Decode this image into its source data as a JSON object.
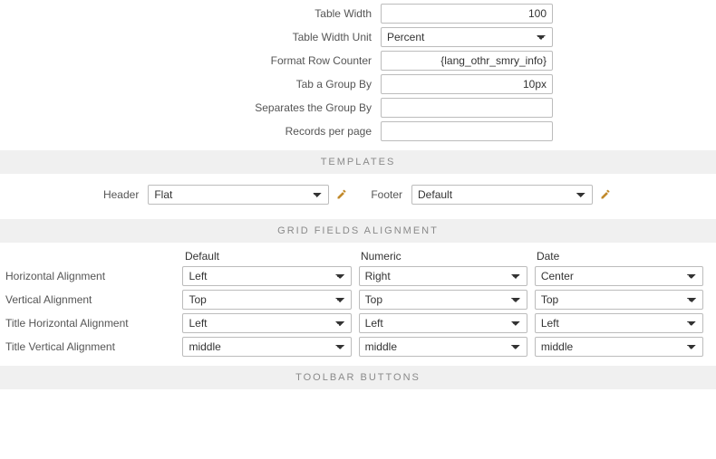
{
  "top_form": {
    "table_width": {
      "label": "Table Width",
      "value": "100"
    },
    "table_width_unit": {
      "label": "Table Width Unit",
      "value": "Percent"
    },
    "format_row_counter": {
      "label": "Format Row Counter",
      "value": "{lang_othr_smry_info}"
    },
    "tab_group_by": {
      "label": "Tab a Group By",
      "value": "10px"
    },
    "separates_group_by": {
      "label": "Separates the Group By",
      "value": ""
    },
    "records_per_page": {
      "label": "Records per page",
      "value": ""
    }
  },
  "sections": {
    "templates": "TEMPLATES",
    "grid_fields_alignment": "GRID FIELDS ALIGNMENT",
    "toolbar_buttons": "TOOLBAR BUTTONS"
  },
  "templates": {
    "header": {
      "label": "Header",
      "value": "Flat"
    },
    "footer": {
      "label": "Footer",
      "value": "Default"
    }
  },
  "alignment": {
    "columns": {
      "default": "Default",
      "numeric": "Numeric",
      "date": "Date"
    },
    "rows": {
      "horizontal": {
        "label": "Horizontal Alignment",
        "default": "Left",
        "numeric": "Right",
        "date": "Center"
      },
      "vertical": {
        "label": "Vertical Alignment",
        "default": "Top",
        "numeric": "Top",
        "date": "Top"
      },
      "title_horizontal": {
        "label": "Title Horizontal Alignment",
        "default": "Left",
        "numeric": "Left",
        "date": "Left"
      },
      "title_vertical": {
        "label": "Title Vertical Alignment",
        "default": "middle",
        "numeric": "middle",
        "date": "middle"
      }
    }
  }
}
